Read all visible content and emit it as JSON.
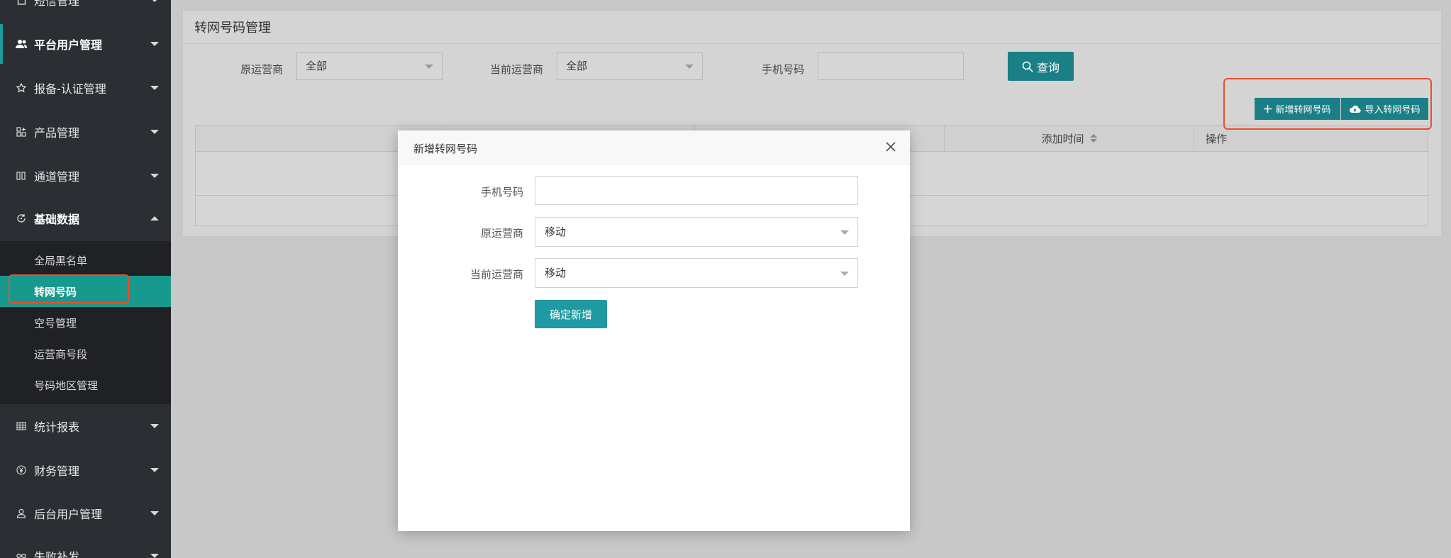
{
  "sidebar": {
    "items": [
      {
        "label": "短信管理",
        "icon": "document-icon"
      },
      {
        "label": "平台用户管理",
        "icon": "users-icon"
      },
      {
        "label": "报备-认证管理",
        "icon": "star-icon"
      },
      {
        "label": "产品管理",
        "icon": "grid-plus-icon"
      },
      {
        "label": "通道管理",
        "icon": "columns-icon"
      },
      {
        "label": "基础数据",
        "icon": "refresh-icon"
      },
      {
        "label": "统计报表",
        "icon": "table-icon"
      },
      {
        "label": "财务管理",
        "icon": "yen-icon"
      },
      {
        "label": "后台用户管理",
        "icon": "user-icon"
      },
      {
        "label": "失败补发",
        "icon": "infinity-icon"
      }
    ],
    "submenu": [
      "全局黑名单",
      "转网号码",
      "空号管理",
      "运营商号段",
      "号码地区管理"
    ]
  },
  "page": {
    "title": "转网号码管理",
    "filters": {
      "original_carrier_label": "原运营商",
      "original_carrier_value": "全部",
      "current_carrier_label": "当前运营商",
      "current_carrier_value": "全部",
      "phone_label": "手机号码",
      "phone_value": ""
    },
    "search_button": "查询",
    "toolbar": {
      "add_button": "新增转网号码",
      "import_button": "导入转网号码"
    },
    "table": {
      "columns": [
        "",
        "",
        "",
        "添加时间",
        "操作"
      ]
    }
  },
  "modal": {
    "title": "新增转网号码",
    "phone_label": "手机号码",
    "phone_value": "",
    "original_carrier_label": "原运营商",
    "original_carrier_value": "移动",
    "current_carrier_label": "当前运营商",
    "current_carrier_value": "移动",
    "confirm_button": "确定新增"
  },
  "colors": {
    "accent": "#1b7f87",
    "sidebar_active": "#17998e",
    "highlight": "#e8502e"
  }
}
